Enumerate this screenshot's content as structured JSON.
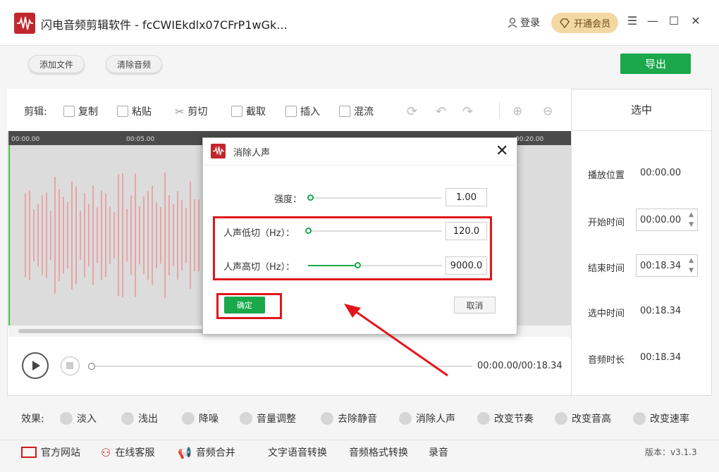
{
  "app": {
    "title": "闪电音频剪辑软件 - fcCWIEkdlx07CFrP1wGk...",
    "login": "登录",
    "vip": "开通会员"
  },
  "top": {
    "add_file": "添加文件",
    "clear_audio": "清除音频",
    "export": "导出"
  },
  "toolbar": {
    "label": "剪辑:",
    "tools": [
      "复制",
      "粘贴",
      "剪切",
      "截取",
      "插入",
      "混流"
    ]
  },
  "ruler": [
    "00:00.00",
    "00:05.00",
    "00:20.00"
  ],
  "player": {
    "time": "00:00.00/00:18.34"
  },
  "panel": {
    "header": "选中",
    "play_pos_label": "播放位置",
    "play_pos": "00:00.00",
    "start_label": "开始时间",
    "start": "00:00.00",
    "end_label": "结束时间",
    "end": "00:18.34",
    "sel_label": "选中时间",
    "sel": "00:18.34",
    "dur_label": "音频时长",
    "dur": "00:18.34"
  },
  "effects": {
    "label": "效果:",
    "items": [
      "淡入",
      "浅出",
      "降噪",
      "音量调整",
      "去除静音",
      "消除人声",
      "改变节奏",
      "改变音高",
      "改变速率"
    ]
  },
  "bottom": {
    "items": [
      "官方网站",
      "在线客服",
      "音频合并",
      "文字语音转换",
      "音频格式转换",
      "录音"
    ],
    "version": "版本：v3.1.3"
  },
  "dialog": {
    "title": "消除人声",
    "strength_label": "强度：",
    "strength": "1.00",
    "strength_level": 0,
    "low_label": "人声低切（Hz）：",
    "low": "120.0",
    "low_level": 0,
    "high_label": "人声高切（Hz）：",
    "high": "9000.0",
    "high_level": 0.37,
    "ok": "确定",
    "cancel": "取消"
  },
  "colors": {
    "accent": "#1aa84a",
    "brand": "#c0272d",
    "highlight": "#e0161b",
    "wave": "#e8a4a4"
  }
}
